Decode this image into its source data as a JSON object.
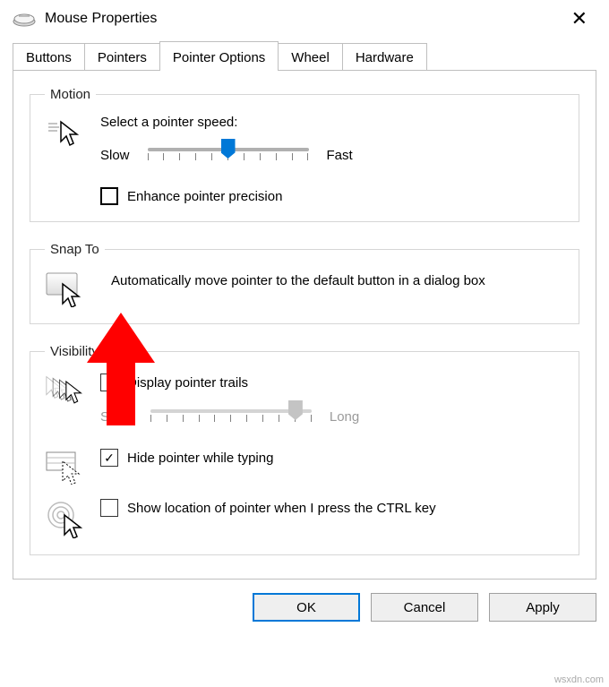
{
  "window": {
    "title": "Mouse Properties",
    "close_icon": "close-icon"
  },
  "tabs": [
    {
      "label": "Buttons",
      "active": false
    },
    {
      "label": "Pointers",
      "active": false
    },
    {
      "label": "Pointer Options",
      "active": true
    },
    {
      "label": "Wheel",
      "active": false
    },
    {
      "label": "Hardware",
      "active": false
    }
  ],
  "motion": {
    "legend": "Motion",
    "speed_label": "Select a pointer speed:",
    "slow": "Slow",
    "fast": "Fast",
    "speed_value": 6,
    "speed_max": 11,
    "enhance_label": "Enhance pointer precision",
    "enhance_checked": false
  },
  "snapto": {
    "legend": "Snap To",
    "auto_move_label": "Automatically move pointer to the default button in a dialog box",
    "auto_move_checked": false
  },
  "visibility": {
    "legend": "Visibility",
    "trails_label": "Display pointer trails",
    "trails_checked": false,
    "trails_short": "Short",
    "trails_long": "Long",
    "trails_value": 10,
    "trails_max": 11,
    "trails_enabled": false,
    "hide_typing_label": "Hide pointer while typing",
    "hide_typing_checked": true,
    "show_location_label": "Show location of pointer when I press the CTRL key",
    "show_location_checked": false
  },
  "buttons": {
    "ok": "OK",
    "cancel": "Cancel",
    "apply": "Apply"
  },
  "watermark": "wsxdn.com"
}
